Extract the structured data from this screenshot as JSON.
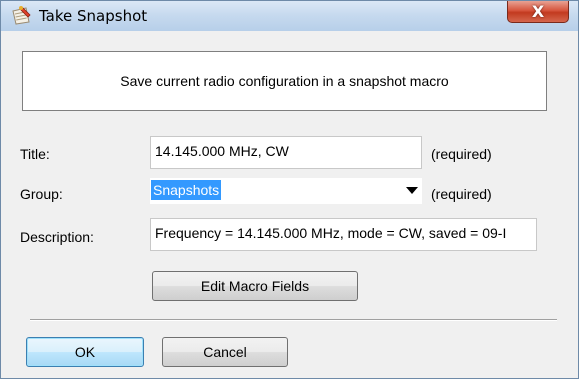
{
  "window": {
    "title": "Take Snapshot",
    "close_glyph": "X"
  },
  "header": {
    "text": "Save current radio configuration in a snapshot macro"
  },
  "form": {
    "title_label": "Title:",
    "title_value": "14.145.000 MHz, CW",
    "title_hint": "(required)",
    "group_label": "Group:",
    "group_value": "Snapshots",
    "group_hint": "(required)",
    "description_label": "Description:",
    "description_value": "Frequency = 14.145.000 MHz, mode = CW, saved = 09-I"
  },
  "buttons": {
    "edit_macro_fields": "Edit Macro Fields",
    "ok": "OK",
    "cancel": "Cancel"
  },
  "icons": {
    "app": "snapshot-app-icon",
    "dropdown": "chevron-down-icon"
  },
  "colors": {
    "selection": "#3399ff",
    "close_button": "#c23a1f",
    "default_button_border": "#3c7fb1"
  }
}
